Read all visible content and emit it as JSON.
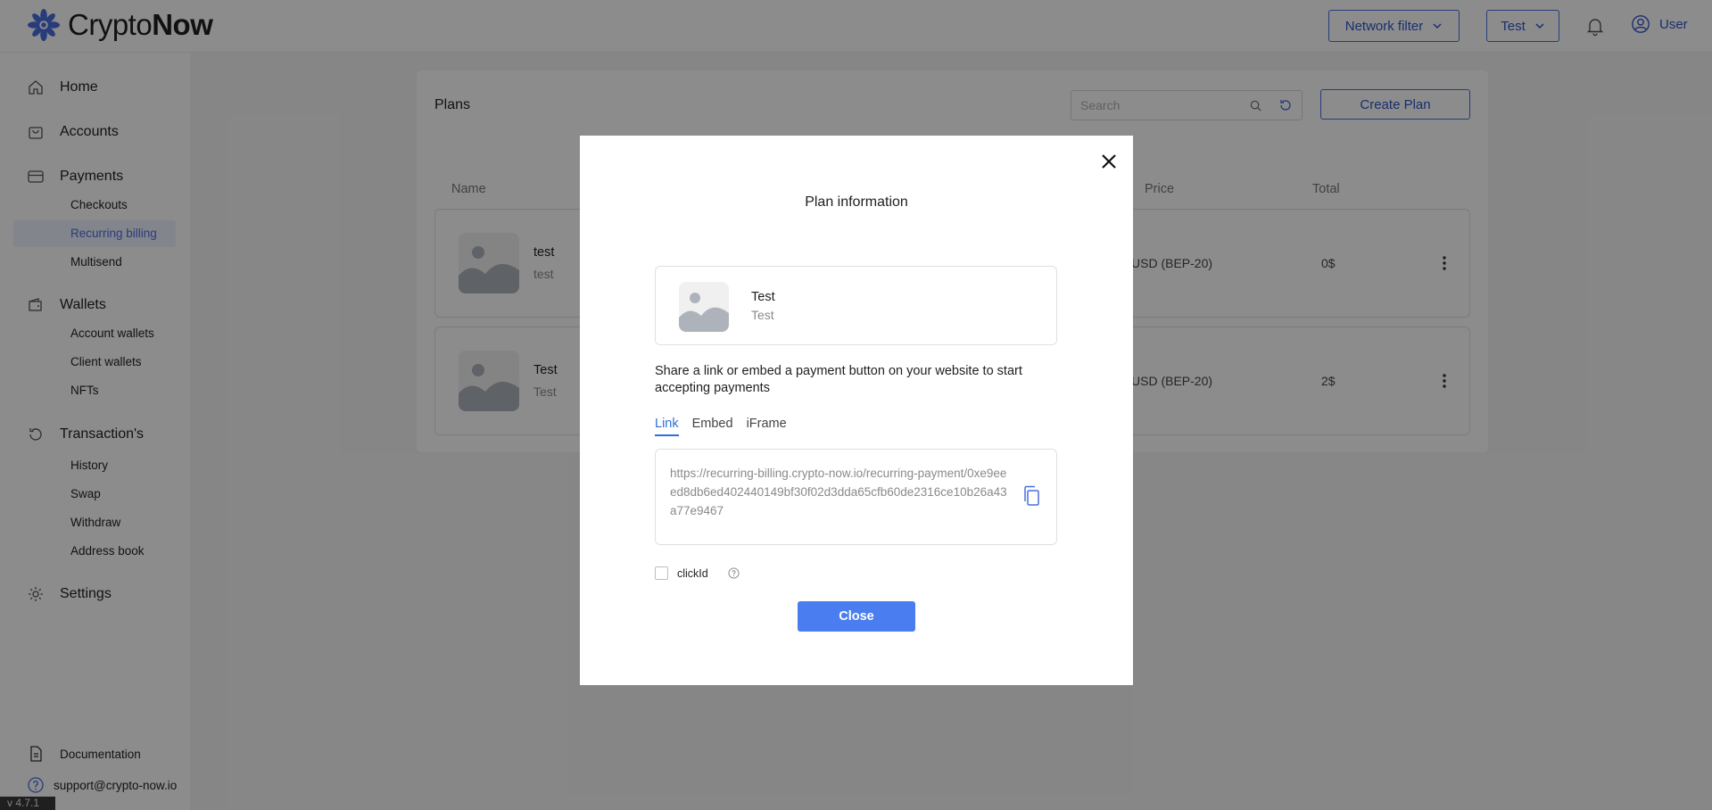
{
  "header": {
    "logo_light": "Crypto",
    "logo_bold": "Now",
    "network_filter_label": "Network filter",
    "env_label": "Test",
    "user_label": "User"
  },
  "sidebar": {
    "home": "Home",
    "accounts": "Accounts",
    "payments": "Payments",
    "payments_items": [
      "Checkouts",
      "Recurring billing",
      "Multisend"
    ],
    "wallets": "Wallets",
    "wallets_items": [
      "Account wallets",
      "Client wallets",
      "NFTs"
    ],
    "transactions": "Transaction's",
    "transactions_items": [
      "History",
      "Swap",
      "Withdraw",
      "Address book"
    ],
    "settings": "Settings",
    "documentation": "Documentation",
    "support": "support@crypto-now.io",
    "version": "v 4.7.1"
  },
  "plans": {
    "title": "Plans",
    "search_placeholder": "Search",
    "create_label": "Create Plan",
    "columns": {
      "name": "Name",
      "price": "Price",
      "total": "Total"
    },
    "rows": [
      {
        "name": "test",
        "desc": "test",
        "price": "USD (BEP-20)",
        "total": "0$"
      },
      {
        "name": "Test",
        "desc": "Test",
        "price": "USD (BEP-20)",
        "total": "2$"
      }
    ]
  },
  "modal": {
    "title": "Plan information",
    "plan_name": "Test",
    "plan_desc": "Test",
    "share_text": "Share a link or embed a payment button on your website to start accepting payments",
    "tabs": [
      "Link",
      "Embed",
      "iFrame"
    ],
    "url": "https://recurring-billing.crypto-now.io/recurring-payment/0xe9eeed8db6ed402440149bf30f02d3dda65cfb60de2316ce10b26a43a77e9467",
    "clickid_label": "clickId",
    "close_label": "Close"
  },
  "colors": {
    "accent": "#4a6ee0",
    "button": "#4a7ef0",
    "active_tab": "#2f6fd6"
  }
}
